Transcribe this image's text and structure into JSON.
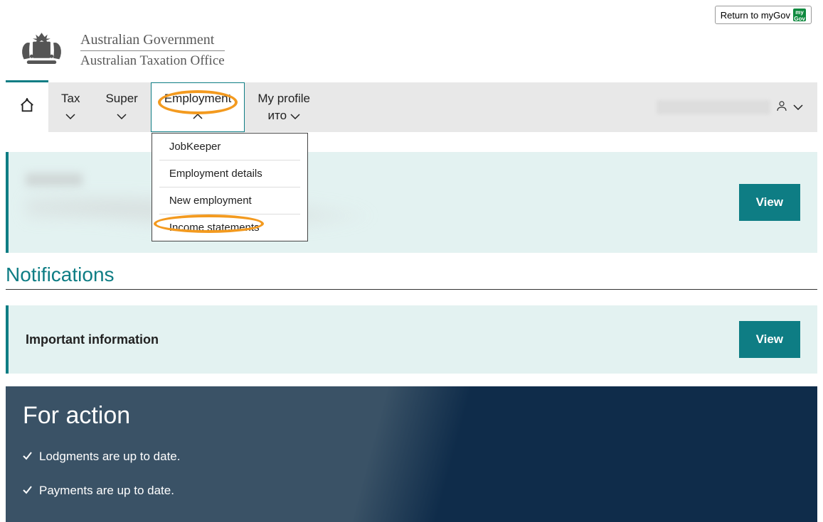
{
  "topbar": {
    "return_label": "Return to myGov",
    "badge_text": "my\nGov"
  },
  "logo": {
    "line1": "Australian Government",
    "line2": "Australian Taxation Office"
  },
  "nav": {
    "tax": "Tax",
    "super": "Super",
    "employment": "Employment",
    "myprofile": "My profile"
  },
  "dropdown": {
    "items": [
      "JobKeeper",
      "Employment details",
      "New employment",
      "Income statements"
    ]
  },
  "banners": {
    "view_label": "View"
  },
  "notifications": {
    "heading": "Notifications",
    "important_label": "Important information"
  },
  "action": {
    "heading": "For action",
    "items": [
      "Lodgments are up to date.",
      "Payments are up to date."
    ]
  }
}
